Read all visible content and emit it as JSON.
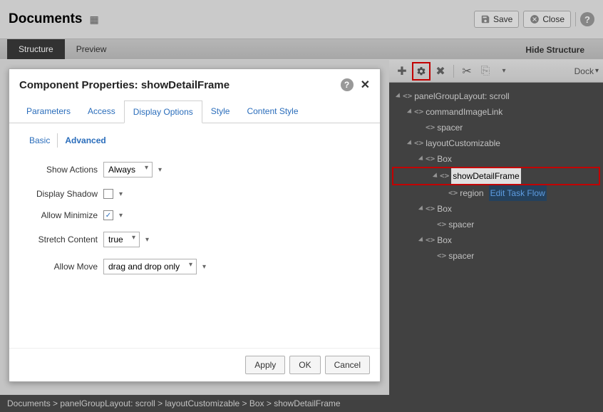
{
  "header": {
    "title": "Documents",
    "save_label": "Save",
    "close_label": "Close"
  },
  "main_tabs": {
    "structure": "Structure",
    "preview": "Preview",
    "hide_structure": "Hide Structure"
  },
  "structure_toolbar": {
    "dock_label": "Dock"
  },
  "tree": {
    "n0": "panelGroupLayout: scroll",
    "n1": "commandImageLink",
    "n2": "spacer",
    "n3": "layoutCustomizable",
    "n4": "Box",
    "n5": "showDetailFrame",
    "n6": "region",
    "n6_link": "Edit Task Flow",
    "n7": "Box",
    "n8": "spacer",
    "n9": "Box",
    "n10": "spacer"
  },
  "breadcrumb": "Documents > panelGroupLayout: scroll > layoutCustomizable > Box > showDetailFrame",
  "dialog": {
    "title": "Component Properties: showDetailFrame",
    "tabs": {
      "parameters": "Parameters",
      "access": "Access",
      "display_options": "Display Options",
      "style": "Style",
      "content_style": "Content Style"
    },
    "subtabs": {
      "basic": "Basic",
      "advanced": "Advanced"
    },
    "fields": {
      "show_actions_label": "Show Actions",
      "show_actions_value": "Always",
      "display_shadow_label": "Display Shadow",
      "display_shadow_checked": false,
      "allow_minimize_label": "Allow Minimize",
      "allow_minimize_checked": true,
      "stretch_content_label": "Stretch Content",
      "stretch_content_value": "true",
      "allow_move_label": "Allow Move",
      "allow_move_value": "drag and drop only"
    },
    "buttons": {
      "apply": "Apply",
      "ok": "OK",
      "cancel": "Cancel"
    }
  }
}
